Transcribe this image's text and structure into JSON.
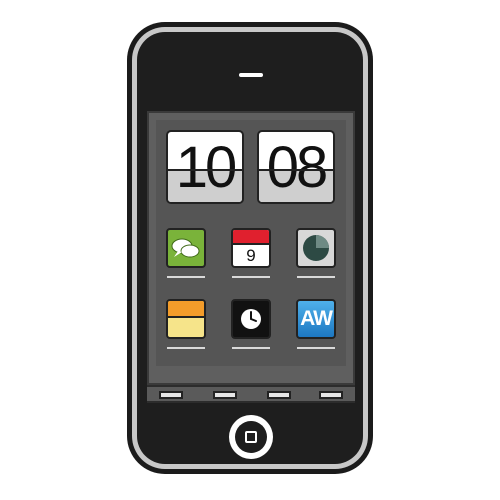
{
  "clock": {
    "hours": "10",
    "minutes": "08"
  },
  "apps": {
    "row1": [
      {
        "icon": "messages-icon"
      },
      {
        "icon": "calendar-icon",
        "day": "9"
      },
      {
        "icon": "chart-icon"
      }
    ],
    "row2": [
      {
        "icon": "notes-icon"
      },
      {
        "icon": "clock-icon"
      },
      {
        "icon": "aw-app-icon",
        "label": "AW"
      }
    ]
  },
  "colors": {
    "messages_green": "#7ab33a",
    "calendar_red": "#e0202e",
    "notes_orange": "#f39c2a",
    "notes_yellow": "#f6e48a",
    "aw_blue": "#2a8fd2",
    "body": "#1e1e1e",
    "screen": "#555555"
  }
}
